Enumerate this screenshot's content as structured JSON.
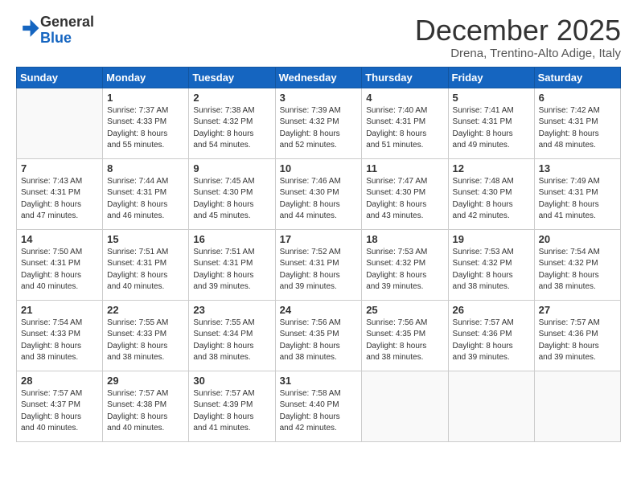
{
  "header": {
    "logo_general": "General",
    "logo_blue": "Blue",
    "month_title": "December 2025",
    "location": "Drena, Trentino-Alto Adige, Italy"
  },
  "weekdays": [
    "Sunday",
    "Monday",
    "Tuesday",
    "Wednesday",
    "Thursday",
    "Friday",
    "Saturday"
  ],
  "weeks": [
    [
      {
        "day": "",
        "info": ""
      },
      {
        "day": "1",
        "info": "Sunrise: 7:37 AM\nSunset: 4:33 PM\nDaylight: 8 hours\nand 55 minutes."
      },
      {
        "day": "2",
        "info": "Sunrise: 7:38 AM\nSunset: 4:32 PM\nDaylight: 8 hours\nand 54 minutes."
      },
      {
        "day": "3",
        "info": "Sunrise: 7:39 AM\nSunset: 4:32 PM\nDaylight: 8 hours\nand 52 minutes."
      },
      {
        "day": "4",
        "info": "Sunrise: 7:40 AM\nSunset: 4:31 PM\nDaylight: 8 hours\nand 51 minutes."
      },
      {
        "day": "5",
        "info": "Sunrise: 7:41 AM\nSunset: 4:31 PM\nDaylight: 8 hours\nand 49 minutes."
      },
      {
        "day": "6",
        "info": "Sunrise: 7:42 AM\nSunset: 4:31 PM\nDaylight: 8 hours\nand 48 minutes."
      }
    ],
    [
      {
        "day": "7",
        "info": "Sunrise: 7:43 AM\nSunset: 4:31 PM\nDaylight: 8 hours\nand 47 minutes."
      },
      {
        "day": "8",
        "info": "Sunrise: 7:44 AM\nSunset: 4:31 PM\nDaylight: 8 hours\nand 46 minutes."
      },
      {
        "day": "9",
        "info": "Sunrise: 7:45 AM\nSunset: 4:30 PM\nDaylight: 8 hours\nand 45 minutes."
      },
      {
        "day": "10",
        "info": "Sunrise: 7:46 AM\nSunset: 4:30 PM\nDaylight: 8 hours\nand 44 minutes."
      },
      {
        "day": "11",
        "info": "Sunrise: 7:47 AM\nSunset: 4:30 PM\nDaylight: 8 hours\nand 43 minutes."
      },
      {
        "day": "12",
        "info": "Sunrise: 7:48 AM\nSunset: 4:30 PM\nDaylight: 8 hours\nand 42 minutes."
      },
      {
        "day": "13",
        "info": "Sunrise: 7:49 AM\nSunset: 4:31 PM\nDaylight: 8 hours\nand 41 minutes."
      }
    ],
    [
      {
        "day": "14",
        "info": "Sunrise: 7:50 AM\nSunset: 4:31 PM\nDaylight: 8 hours\nand 40 minutes."
      },
      {
        "day": "15",
        "info": "Sunrise: 7:51 AM\nSunset: 4:31 PM\nDaylight: 8 hours\nand 40 minutes."
      },
      {
        "day": "16",
        "info": "Sunrise: 7:51 AM\nSunset: 4:31 PM\nDaylight: 8 hours\nand 39 minutes."
      },
      {
        "day": "17",
        "info": "Sunrise: 7:52 AM\nSunset: 4:31 PM\nDaylight: 8 hours\nand 39 minutes."
      },
      {
        "day": "18",
        "info": "Sunrise: 7:53 AM\nSunset: 4:32 PM\nDaylight: 8 hours\nand 39 minutes."
      },
      {
        "day": "19",
        "info": "Sunrise: 7:53 AM\nSunset: 4:32 PM\nDaylight: 8 hours\nand 38 minutes."
      },
      {
        "day": "20",
        "info": "Sunrise: 7:54 AM\nSunset: 4:32 PM\nDaylight: 8 hours\nand 38 minutes."
      }
    ],
    [
      {
        "day": "21",
        "info": "Sunrise: 7:54 AM\nSunset: 4:33 PM\nDaylight: 8 hours\nand 38 minutes."
      },
      {
        "day": "22",
        "info": "Sunrise: 7:55 AM\nSunset: 4:33 PM\nDaylight: 8 hours\nand 38 minutes."
      },
      {
        "day": "23",
        "info": "Sunrise: 7:55 AM\nSunset: 4:34 PM\nDaylight: 8 hours\nand 38 minutes."
      },
      {
        "day": "24",
        "info": "Sunrise: 7:56 AM\nSunset: 4:35 PM\nDaylight: 8 hours\nand 38 minutes."
      },
      {
        "day": "25",
        "info": "Sunrise: 7:56 AM\nSunset: 4:35 PM\nDaylight: 8 hours\nand 38 minutes."
      },
      {
        "day": "26",
        "info": "Sunrise: 7:57 AM\nSunset: 4:36 PM\nDaylight: 8 hours\nand 39 minutes."
      },
      {
        "day": "27",
        "info": "Sunrise: 7:57 AM\nSunset: 4:36 PM\nDaylight: 8 hours\nand 39 minutes."
      }
    ],
    [
      {
        "day": "28",
        "info": "Sunrise: 7:57 AM\nSunset: 4:37 PM\nDaylight: 8 hours\nand 40 minutes."
      },
      {
        "day": "29",
        "info": "Sunrise: 7:57 AM\nSunset: 4:38 PM\nDaylight: 8 hours\nand 40 minutes."
      },
      {
        "day": "30",
        "info": "Sunrise: 7:57 AM\nSunset: 4:39 PM\nDaylight: 8 hours\nand 41 minutes."
      },
      {
        "day": "31",
        "info": "Sunrise: 7:58 AM\nSunset: 4:40 PM\nDaylight: 8 hours\nand 42 minutes."
      },
      {
        "day": "",
        "info": ""
      },
      {
        "day": "",
        "info": ""
      },
      {
        "day": "",
        "info": ""
      }
    ]
  ]
}
